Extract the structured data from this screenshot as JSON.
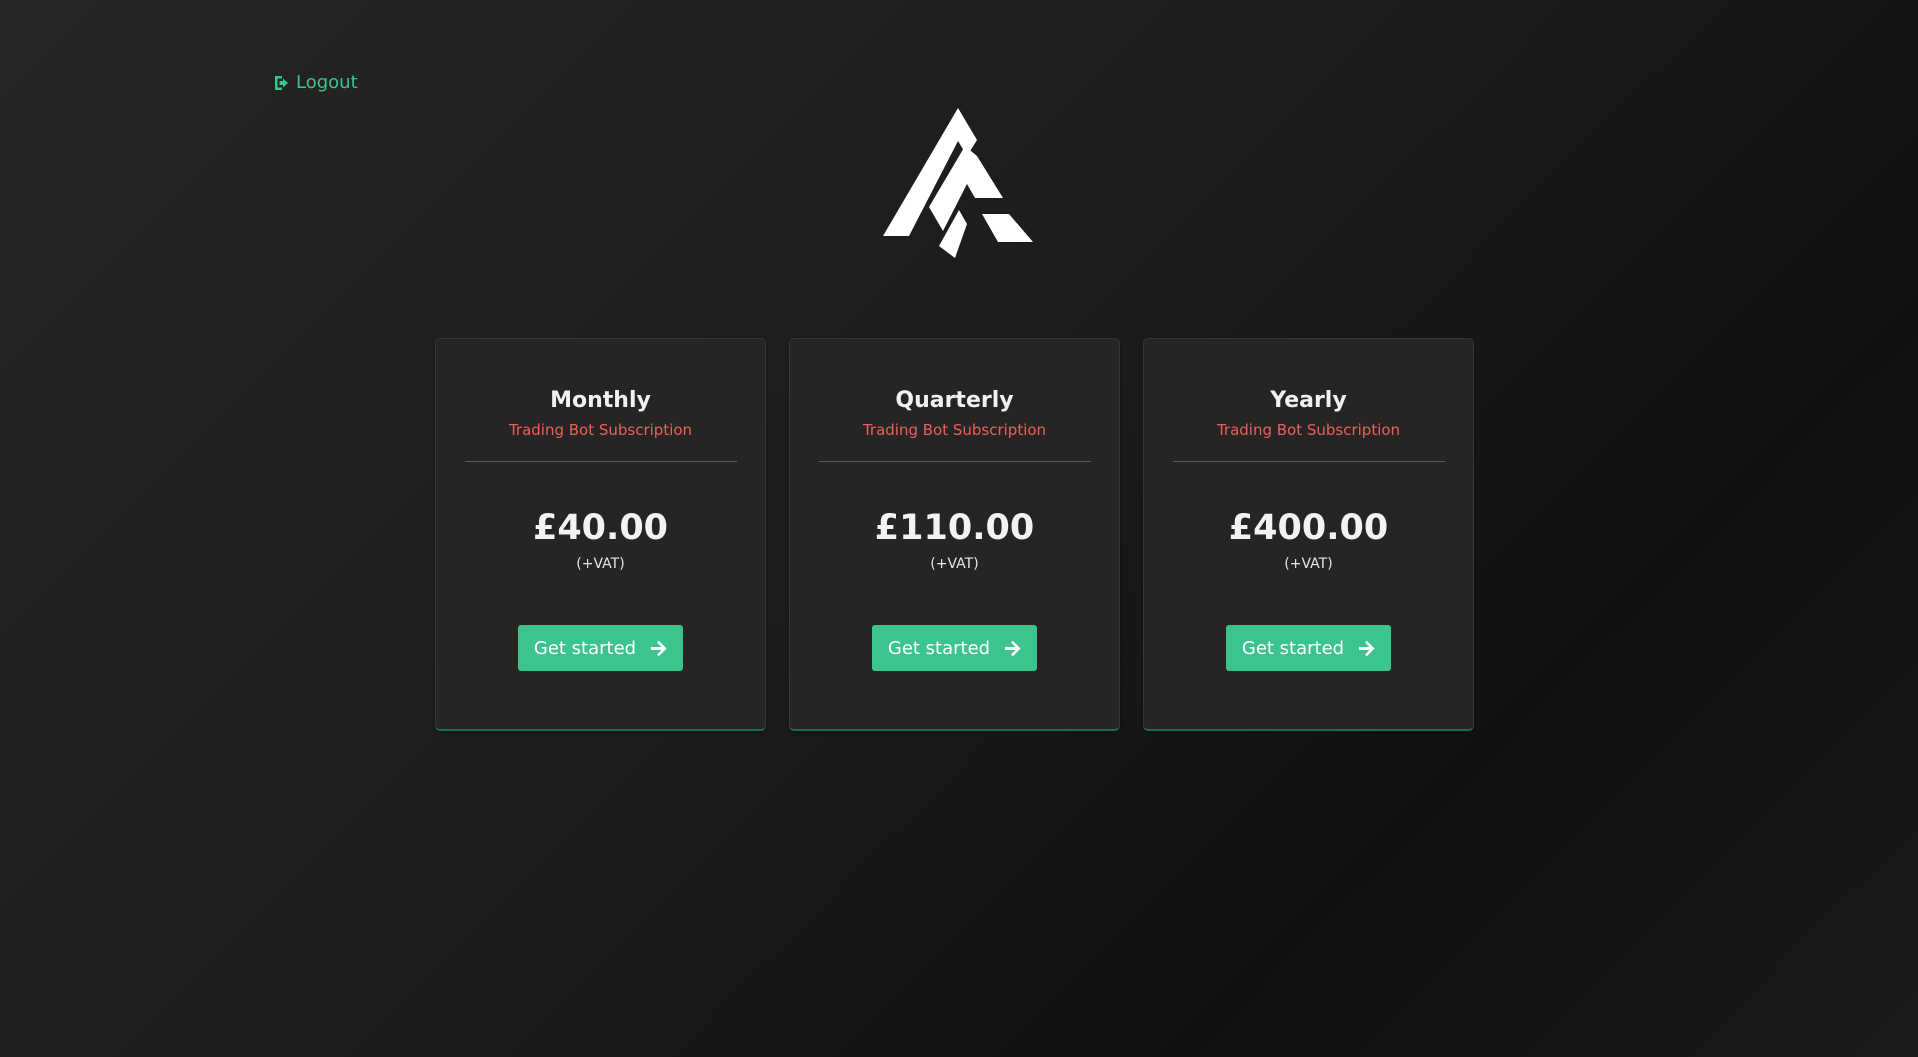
{
  "header": {
    "logout_label": "Logout"
  },
  "colors": {
    "accent": "#3cc48f",
    "subtitle": "#e8615f",
    "card_bg": "#272523"
  },
  "plans": [
    {
      "title": "Monthly",
      "subtitle": "Trading Bot Subscription",
      "price": "£40.00",
      "vat": "(+VAT)",
      "button_label": "Get started"
    },
    {
      "title": "Quarterly",
      "subtitle": "Trading Bot Subscription",
      "price": "£110.00",
      "vat": "(+VAT)",
      "button_label": "Get started"
    },
    {
      "title": "Yearly",
      "subtitle": "Trading Bot Subscription",
      "price": "£400.00",
      "vat": "(+VAT)",
      "button_label": "Get started"
    }
  ]
}
